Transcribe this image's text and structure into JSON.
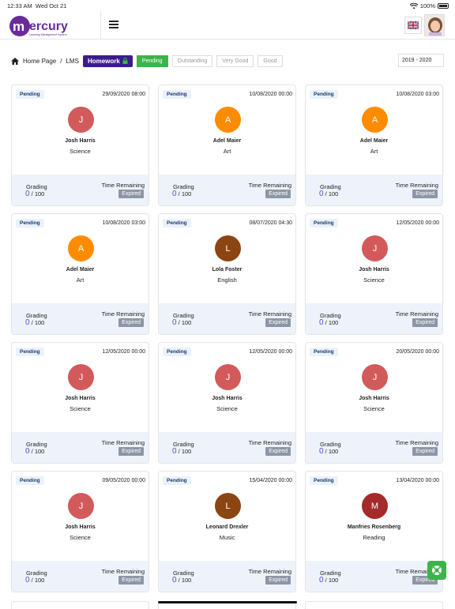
{
  "status": {
    "time": "12:33 AM",
    "date": "Wed Oct 21",
    "battery": "100%"
  },
  "header": {
    "logo_text": "mercury",
    "logo_tagline": "Learning Management System"
  },
  "breadcrumb": {
    "home": "Home Page",
    "sep": "/",
    "lms": "LMS",
    "homework": "Homework"
  },
  "filters": [
    "Pending",
    "Outstanding",
    "Very Good",
    "Good"
  ],
  "year": "2019 - 2020",
  "labels": {
    "grading": "Grading",
    "time_remaining": "Time Remaining",
    "expired": "Expired",
    "out_of": "/ 100"
  },
  "colors": {
    "accent": "#3b1c8c",
    "green": "#3cb449",
    "score": "#5b4bd6"
  },
  "cards": [
    {
      "status": "Pending",
      "date": "29/09/2020 08:00",
      "initial": "J",
      "name": "Josh Harris",
      "subject": "Science",
      "color": "#d35a5a",
      "score": "0"
    },
    {
      "status": "Pending",
      "date": "10/08/2020 00:00",
      "initial": "A",
      "name": "Adel Maier",
      "subject": "Art",
      "color": "#ff8c00",
      "score": "0"
    },
    {
      "status": "Pending",
      "date": "10/08/2020 03:00",
      "initial": "A",
      "name": "Adel Maier",
      "subject": "Art",
      "color": "#ff8c00",
      "score": "0"
    },
    {
      "status": "Pending",
      "date": "10/08/2020 03:00",
      "initial": "A",
      "name": "Adel Maier",
      "subject": "Art",
      "color": "#ff8c00",
      "score": "0"
    },
    {
      "status": "Pending",
      "date": "08/07/2020 04:30",
      "initial": "L",
      "name": "Lola Foster",
      "subject": "English",
      "color": "#8b4513",
      "score": "0"
    },
    {
      "status": "Pending",
      "date": "12/05/2020 00:00",
      "initial": "J",
      "name": "Josh Harris",
      "subject": "Science",
      "color": "#d35a5a",
      "score": "0"
    },
    {
      "status": "Pending",
      "date": "12/05/2020 00:00",
      "initial": "J",
      "name": "Josh Harris",
      "subject": "Science",
      "color": "#d35a5a",
      "score": "0"
    },
    {
      "status": "Pending",
      "date": "12/05/2020 00:00",
      "initial": "J",
      "name": "Josh Harris",
      "subject": "Science",
      "color": "#d35a5a",
      "score": "0"
    },
    {
      "status": "Pending",
      "date": "20/05/2020 00:00",
      "initial": "J",
      "name": "Josh Harris",
      "subject": "Science",
      "color": "#d35a5a",
      "score": "0"
    },
    {
      "status": "Pending",
      "date": "09/05/2020 00:00",
      "initial": "J",
      "name": "Josh Harris",
      "subject": "Science",
      "color": "#d35a5a",
      "score": "0"
    },
    {
      "status": "Pending",
      "date": "15/04/2020 00:00",
      "initial": "L",
      "name": "Leonard Drexler",
      "subject": "Music",
      "color": "#8b4513",
      "score": "0"
    },
    {
      "status": "Pending",
      "date": "13/04/2020 00:00",
      "initial": "M",
      "name": "Manfries Rosenberg",
      "subject": "Reading",
      "color": "#a52a2a",
      "score": "0"
    }
  ]
}
